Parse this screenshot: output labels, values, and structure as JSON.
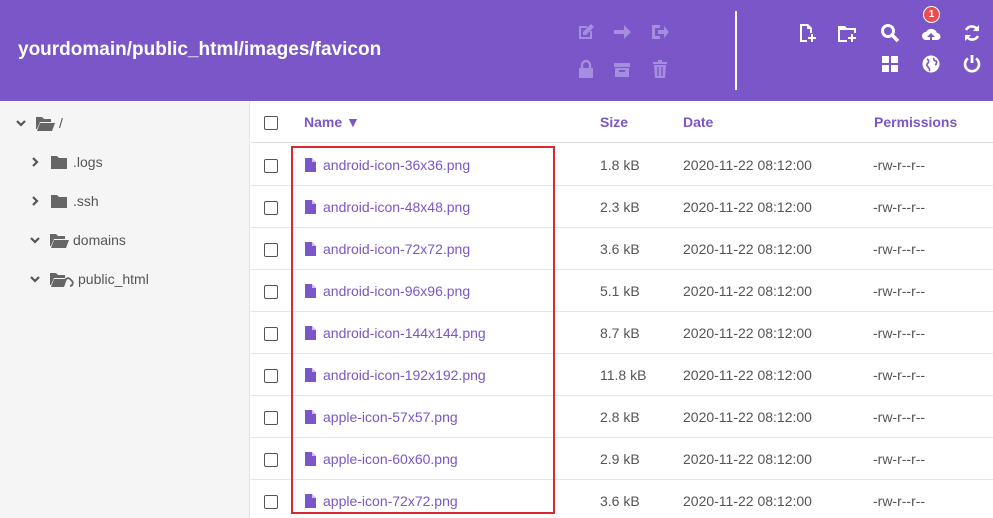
{
  "header": {
    "path_title": "yourdomain/public_html/images/favicon",
    "icons": {
      "edit": "edit-icon",
      "move": "arrow-right-icon",
      "exit": "sign-out-icon",
      "lock": "lock-icon",
      "archive": "archive-icon",
      "delete": "trash-icon",
      "new_file": "file-plus-icon",
      "new_folder": "folder-plus-icon",
      "search": "search-icon",
      "upload": "upload-cloud-icon",
      "refresh": "refresh-icon",
      "grid": "grid-icon",
      "language": "globe-icon",
      "logout": "power-icon"
    },
    "upload_badge": "1",
    "colors": {
      "bar": "#7a56c8",
      "badge": "#ea4d4d"
    }
  },
  "sidebar": {
    "items": [
      {
        "label": "/",
        "expanded": true
      },
      {
        "label": ".logs",
        "expanded": false
      },
      {
        "label": ".ssh",
        "expanded": false
      },
      {
        "label": "domains",
        "expanded": true
      },
      {
        "label": "public_html",
        "expanded": true
      }
    ]
  },
  "table": {
    "headers": {
      "name": "Name ▼",
      "size": "Size",
      "date": "Date",
      "permissions": "Permissions"
    },
    "rows": [
      {
        "name": "android-icon-36x36.png",
        "size": "1.8 kB",
        "date": "2020-11-22 08:12:00",
        "permissions": "-rw-r--r--"
      },
      {
        "name": "android-icon-48x48.png",
        "size": "2.3 kB",
        "date": "2020-11-22 08:12:00",
        "permissions": "-rw-r--r--"
      },
      {
        "name": "android-icon-72x72.png",
        "size": "3.6 kB",
        "date": "2020-11-22 08:12:00",
        "permissions": "-rw-r--r--"
      },
      {
        "name": "android-icon-96x96.png",
        "size": "5.1 kB",
        "date": "2020-11-22 08:12:00",
        "permissions": "-rw-r--r--"
      },
      {
        "name": "android-icon-144x144.png",
        "size": "8.7 kB",
        "date": "2020-11-22 08:12:00",
        "permissions": "-rw-r--r--"
      },
      {
        "name": "android-icon-192x192.png",
        "size": "11.8 kB",
        "date": "2020-11-22 08:12:00",
        "permissions": "-rw-r--r--"
      },
      {
        "name": "apple-icon-57x57.png",
        "size": "2.8 kB",
        "date": "2020-11-22 08:12:00",
        "permissions": "-rw-r--r--"
      },
      {
        "name": "apple-icon-60x60.png",
        "size": "2.9 kB",
        "date": "2020-11-22 08:12:00",
        "permissions": "-rw-r--r--"
      },
      {
        "name": "apple-icon-72x72.png",
        "size": "3.6 kB",
        "date": "2020-11-22 08:12:00",
        "permissions": "-rw-r--r--"
      }
    ]
  }
}
